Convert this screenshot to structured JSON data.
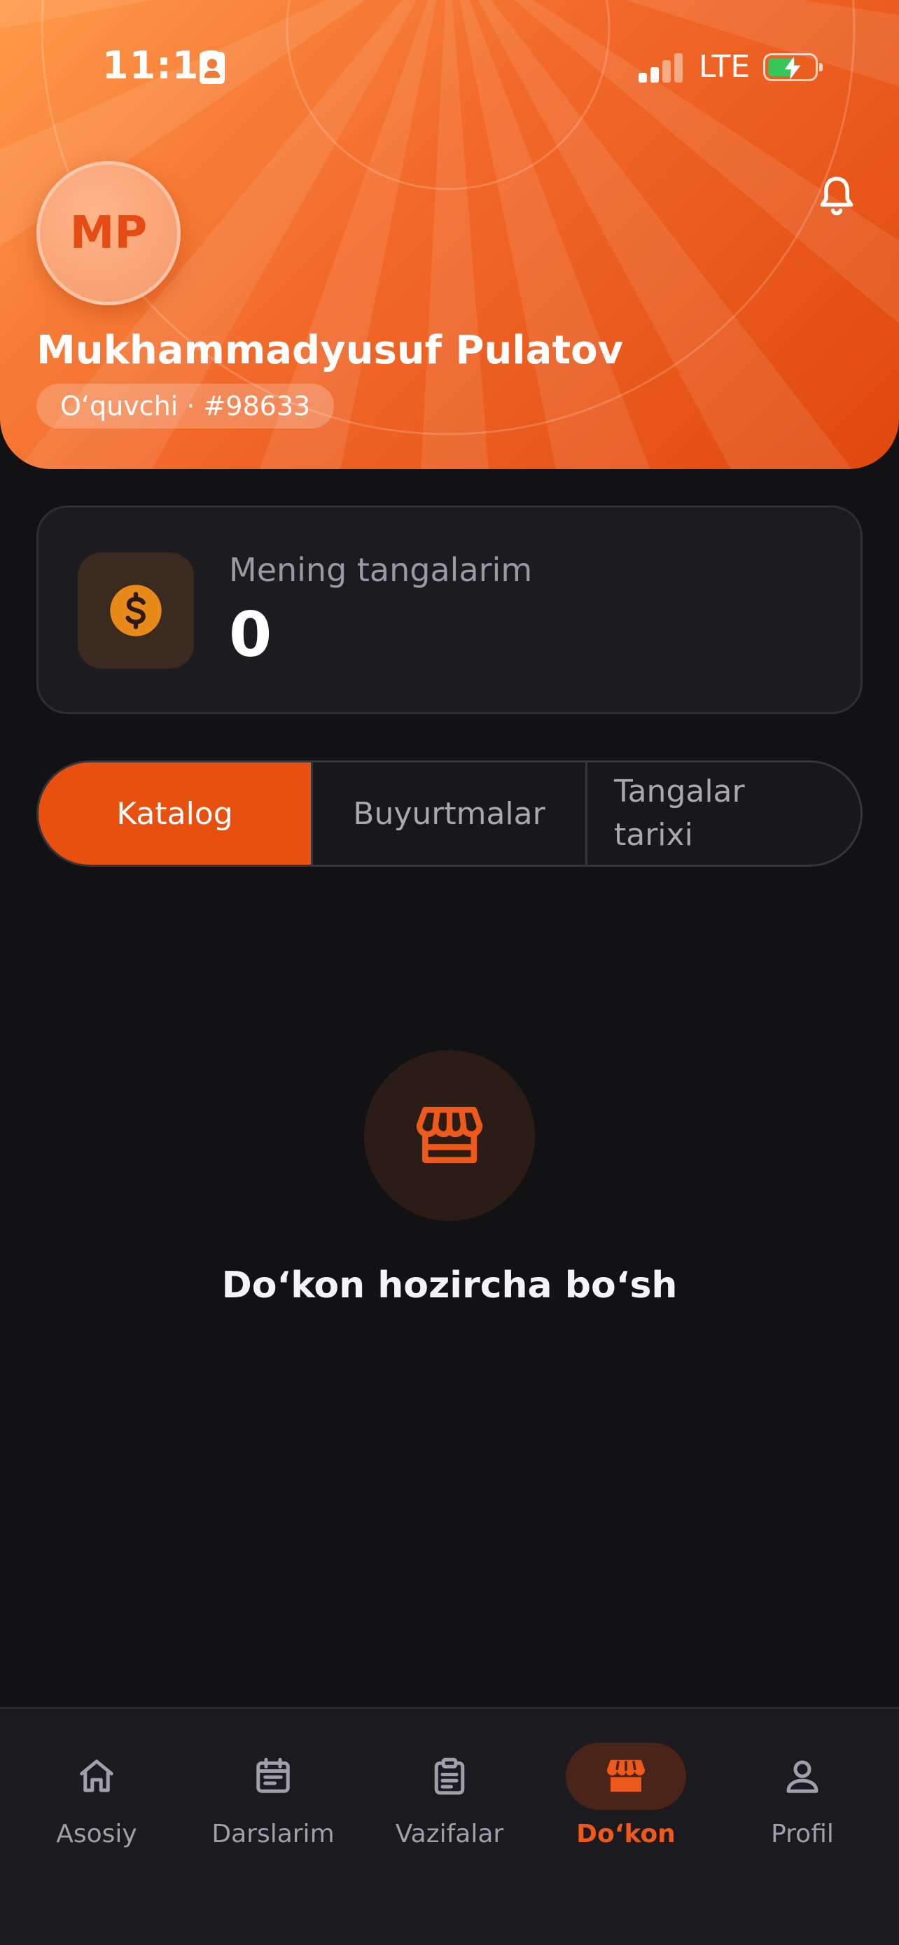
{
  "status_bar": {
    "time": "11:13",
    "network": "LTE",
    "battery_charging": true,
    "id_icon": "contact-card-icon",
    "signal_icon": "cellular-signal-icon",
    "battery_icon": "battery-charging-icon"
  },
  "header": {
    "avatar_initials": "MP",
    "name": "Mukhammadyusuf Pulatov",
    "role_badge": "O‘quvchi · #98633",
    "notification_icon": "bell-icon",
    "accent_color": "#e8500f"
  },
  "coins": {
    "label": "Mening tangalarim",
    "value": "0",
    "icon": "dollar-coin-icon"
  },
  "tabs": [
    {
      "label": "Katalog",
      "active": true
    },
    {
      "label": "Buyurtmalar",
      "active": false
    },
    {
      "label": "Tangalar tarixi",
      "active": false
    }
  ],
  "empty_state": {
    "icon": "store-icon",
    "message": "Do‘kon hozircha bo‘sh"
  },
  "bottom_nav": [
    {
      "label": "Asosiy",
      "icon": "home-icon",
      "active": false
    },
    {
      "label": "Darslarim",
      "icon": "calendar-list-icon",
      "active": false
    },
    {
      "label": "Vazifalar",
      "icon": "clipboard-icon",
      "active": false
    },
    {
      "label": "Do‘kon",
      "icon": "store-icon",
      "active": true
    },
    {
      "label": "Profil",
      "icon": "user-icon",
      "active": false
    }
  ]
}
